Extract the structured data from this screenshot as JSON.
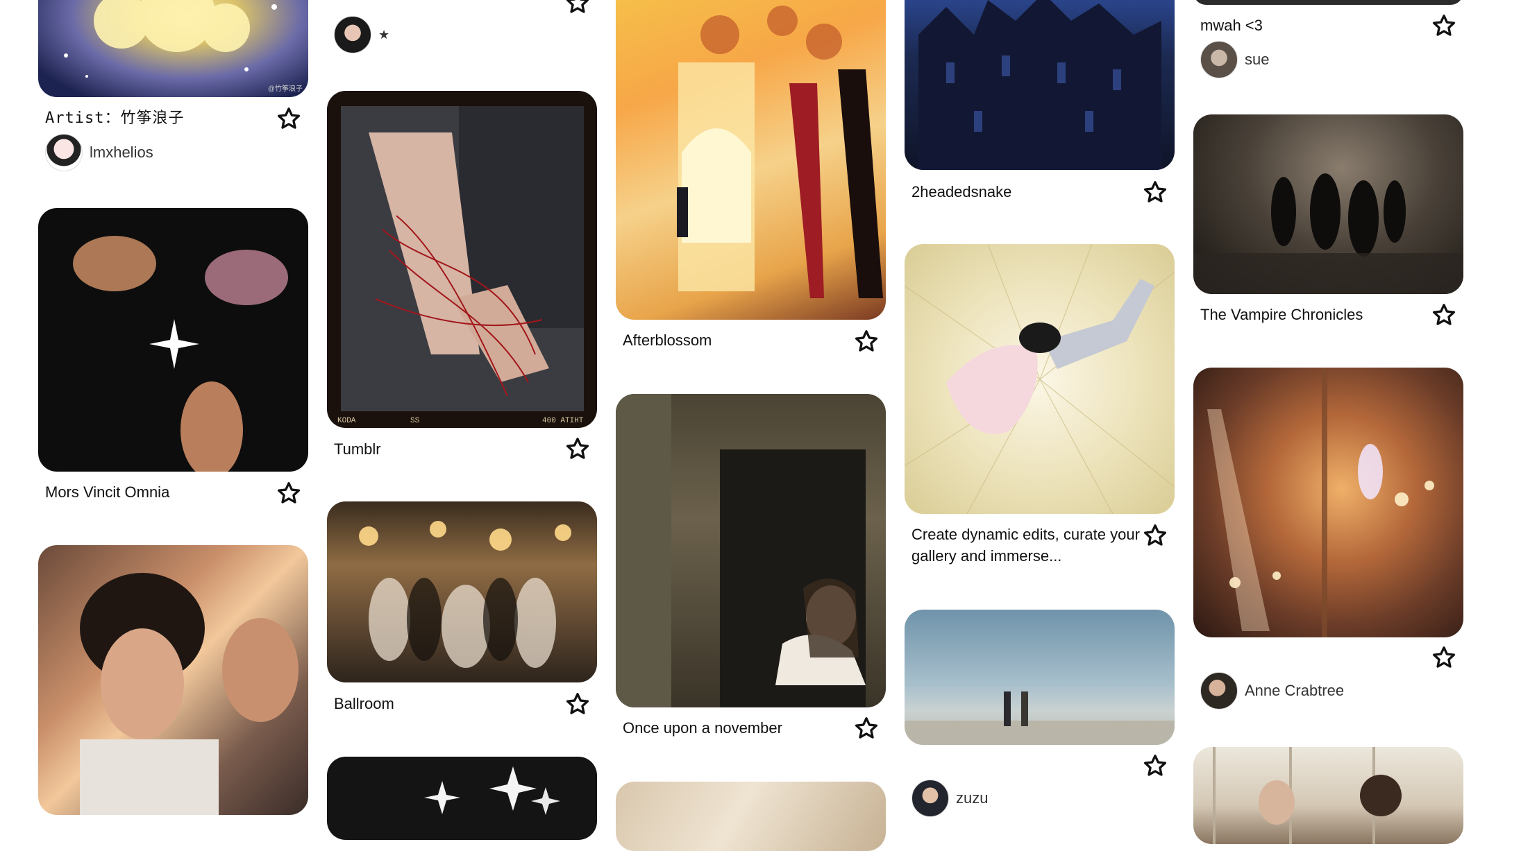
{
  "pins": {
    "p1": {
      "title": "Artist：竹筝浪子",
      "user": "lmxhelios",
      "watermark": "@竹筝浪子"
    },
    "p2": {
      "title": "Mors Vincit Omnia"
    },
    "p3": {},
    "p4": {
      "user": "★"
    },
    "p5": {
      "title": "Tumblr",
      "film_marks": [
        "KODA",
        "SS",
        "400 ATIHT"
      ]
    },
    "p6": {
      "title": "Ballroom"
    },
    "p7": {},
    "p8": {
      "title": "Afterblossom"
    },
    "p9": {
      "title": "Once upon a november"
    },
    "p10": {},
    "p11": {
      "title": "2headedsnake"
    },
    "p12": {
      "title": "Create dynamic edits, curate your gallery and immerse..."
    },
    "p13": {
      "user": "zuzu"
    },
    "p14": {
      "title": "mwah <3",
      "user": "sue"
    },
    "p15": {
      "title": "The Vampire Chronicles"
    },
    "p16": {
      "user": "Anne Crabtree"
    },
    "p17": {}
  },
  "icons": {
    "save": "star-outline-icon"
  },
  "colors": {
    "text": "#111111",
    "username": "#333333",
    "background": "#ffffff"
  }
}
